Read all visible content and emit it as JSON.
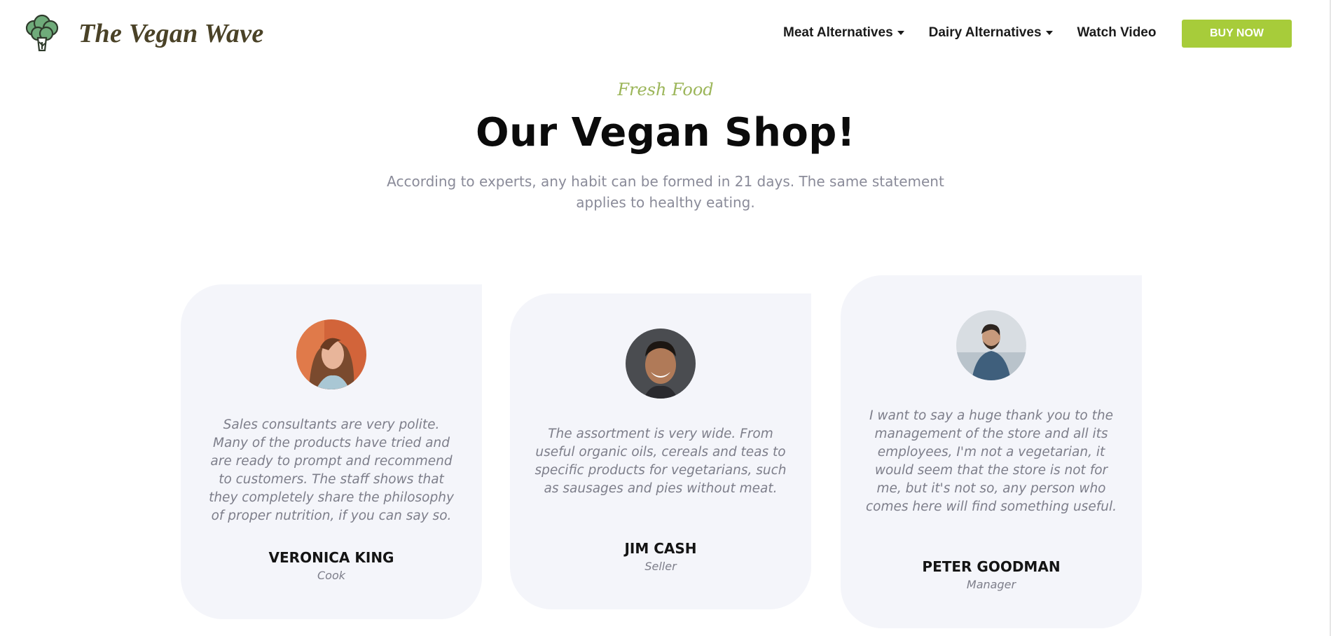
{
  "header": {
    "logo_text": "The Vegan Wave",
    "logo_icon": "broccoli-icon",
    "nav": [
      {
        "label": "Meat Alternatives",
        "has_dropdown": true
      },
      {
        "label": "Dairy Alternatives",
        "has_dropdown": true
      },
      {
        "label": "Watch Video",
        "has_dropdown": false
      }
    ],
    "buy_button": "BUY NOW"
  },
  "hero": {
    "kicker": "Fresh Food",
    "title": "Our Vegan Shop!",
    "subtitle": "According to experts, any habit can be formed in 21 days. The same statement applies to healthy eating."
  },
  "testimonials": [
    {
      "quote": "Sales consultants are very polite. Many of the products have tried and are ready to prompt and recommend to customers. The staff shows that they completely share the philosophy of proper nutrition, if you can say so.",
      "name": "VERONICA KING",
      "role": "Cook"
    },
    {
      "quote": "The assortment is very wide. From useful organic oils, cereals and teas to specific products for vegetarians, such as sausages and pies without meat.",
      "name": "JIM CASH",
      "role": "Seller"
    },
    {
      "quote": "I want to say a huge thank you to the management of the store and all its employees, I'm not a vegetarian, it would seem that the store is not for me, but it's not so, any person who comes here will find something useful.",
      "name": "PETER GOODMAN",
      "role": "Manager"
    }
  ],
  "colors": {
    "accent": "#a7cc3a",
    "kicker": "#9cb65a",
    "logo_text": "#4a4227",
    "card_bg": "#f4f5fa",
    "muted_text": "#8a8b99"
  }
}
